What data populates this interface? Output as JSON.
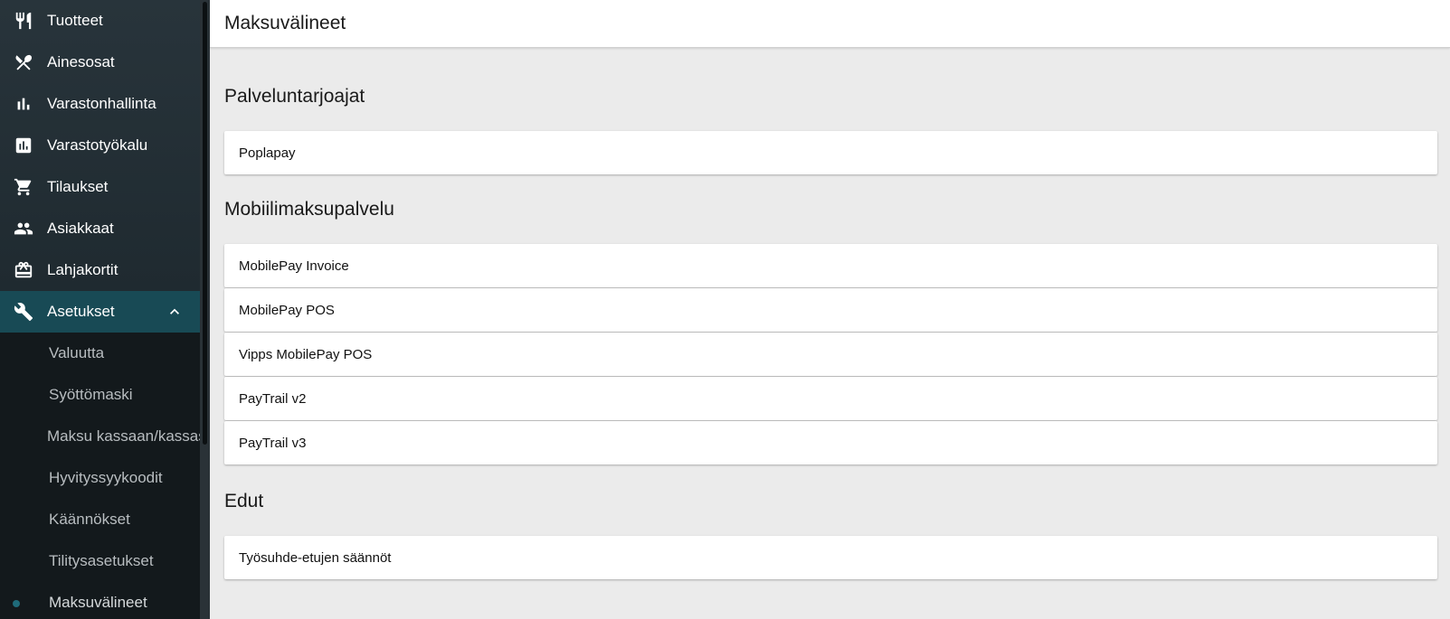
{
  "sidebar": {
    "items": [
      {
        "label": "Tuotteet",
        "icon": "fork-knife-icon"
      },
      {
        "label": "Ainesosat",
        "icon": "crossed-utensils-icon"
      },
      {
        "label": "Varastonhallinta",
        "icon": "bar-chart-icon"
      },
      {
        "label": "Varastotyökalu",
        "icon": "chart-box-icon"
      },
      {
        "label": "Tilaukset",
        "icon": "shopping-cart-icon"
      },
      {
        "label": "Asiakkaat",
        "icon": "people-icon"
      },
      {
        "label": "Lahjakortit",
        "icon": "gift-card-icon"
      },
      {
        "label": "Asetukset",
        "icon": "wrench-icon",
        "expanded": true
      }
    ],
    "subitems": [
      {
        "label": "Valuutta"
      },
      {
        "label": "Syöttömaski"
      },
      {
        "label": "Maksu kassaan/kassasta"
      },
      {
        "label": "Hyvityssyykoodit"
      },
      {
        "label": "Käännökset"
      },
      {
        "label": "Tilitysasetukset"
      },
      {
        "label": "Maksuvälineet",
        "current": true
      }
    ],
    "colors": {
      "background": "#13191c",
      "active": "#184a55",
      "accent_dot": "#1f6b7a"
    }
  },
  "header": {
    "title": "Maksuvälineet"
  },
  "sections": [
    {
      "title": "Palveluntarjoajat",
      "items": [
        "Poplapay"
      ]
    },
    {
      "title": "Mobiilimaksupalvelu",
      "items": [
        "MobilePay Invoice",
        "MobilePay POS",
        "Vipps MobilePay POS",
        "PayTrail v2",
        "PayTrail v3"
      ]
    },
    {
      "title": "Edut",
      "items": [
        "Työsuhde-etujen säännöt"
      ]
    }
  ]
}
